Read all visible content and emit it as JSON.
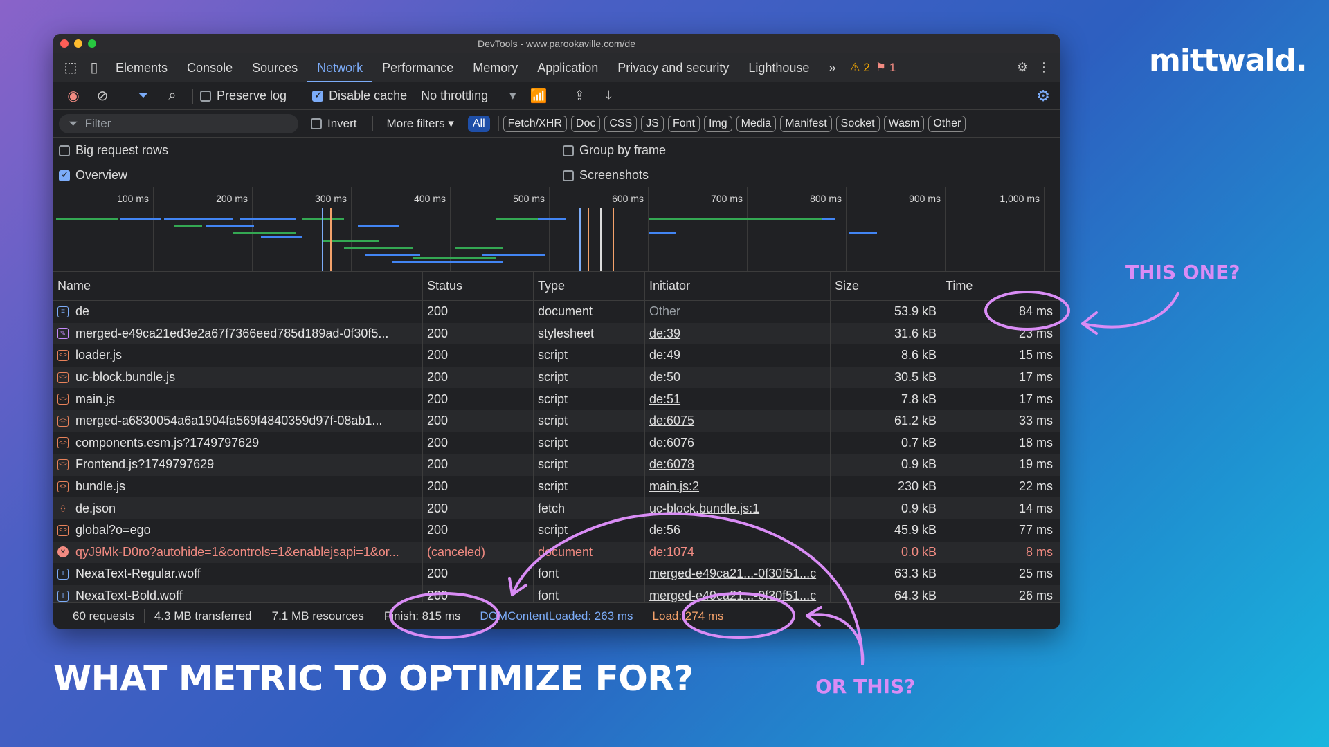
{
  "brand": {
    "logo": "mittwald."
  },
  "headline": "WHAT METRIC TO OPTIMIZE FOR?",
  "annotations": {
    "a": "THIS ONE?",
    "b": "OR THIS?"
  },
  "window": {
    "title": "DevTools - www.parookaville.com/de"
  },
  "tabs": {
    "items": [
      "Elements",
      "Console",
      "Sources",
      "Network",
      "Performance",
      "Memory",
      "Application",
      "Privacy and security",
      "Lighthouse"
    ],
    "active": "Network",
    "more": "»",
    "warnings": "2",
    "errors": "1"
  },
  "toolbar": {
    "preserve_log": "Preserve log",
    "disable_cache": "Disable cache",
    "throttling": "No throttling"
  },
  "filter": {
    "placeholder": "Filter",
    "invert": "Invert",
    "more_filters": "More filters",
    "chips": [
      "All",
      "Fetch/XHR",
      "Doc",
      "CSS",
      "JS",
      "Font",
      "Img",
      "Media",
      "Manifest",
      "Socket",
      "Wasm",
      "Other"
    ]
  },
  "options": {
    "big_rows": "Big request rows",
    "overview": "Overview",
    "group_by_frame": "Group by frame",
    "screenshots": "Screenshots"
  },
  "overview_ticks": [
    "100 ms",
    "200 ms",
    "300 ms",
    "400 ms",
    "500 ms",
    "600 ms",
    "700 ms",
    "800 ms",
    "900 ms",
    "1,000 ms"
  ],
  "table": {
    "headers": [
      "Name",
      "Status",
      "Type",
      "Initiator",
      "Size",
      "Time"
    ],
    "rows": [
      {
        "name": "de",
        "status": "200",
        "type": "document",
        "initiator": "Other",
        "size": "53.9 kB",
        "time": "84 ms"
      },
      {
        "name": "merged-e49ca21ed3e2a67f7366eed785d189ad-0f30f5...",
        "status": "200",
        "type": "stylesheet",
        "initiator": "de:39",
        "size": "31.6 kB",
        "time": "23 ms"
      },
      {
        "name": "loader.js",
        "status": "200",
        "type": "script",
        "initiator": "de:49",
        "size": "8.6 kB",
        "time": "15 ms"
      },
      {
        "name": "uc-block.bundle.js",
        "status": "200",
        "type": "script",
        "initiator": "de:50",
        "size": "30.5 kB",
        "time": "17 ms"
      },
      {
        "name": "main.js",
        "status": "200",
        "type": "script",
        "initiator": "de:51",
        "size": "7.8 kB",
        "time": "17 ms"
      },
      {
        "name": "merged-a6830054a6a1904fa569f4840359d97f-08ab1...",
        "status": "200",
        "type": "script",
        "initiator": "de:6075",
        "size": "61.2 kB",
        "time": "33 ms"
      },
      {
        "name": "components.esm.js?1749797629",
        "status": "200",
        "type": "script",
        "initiator": "de:6076",
        "size": "0.7 kB",
        "time": "18 ms"
      },
      {
        "name": "Frontend.js?1749797629",
        "status": "200",
        "type": "script",
        "initiator": "de:6078",
        "size": "0.9 kB",
        "time": "19 ms"
      },
      {
        "name": "bundle.js",
        "status": "200",
        "type": "script",
        "initiator": "main.js:2",
        "size": "230 kB",
        "time": "22 ms"
      },
      {
        "name": "de.json",
        "status": "200",
        "type": "fetch",
        "initiator": "uc-block.bundle.js:1",
        "size": "0.9 kB",
        "time": "14 ms"
      },
      {
        "name": "global?o=ego",
        "status": "200",
        "type": "script",
        "initiator": "de:56",
        "size": "45.9 kB",
        "time": "77 ms"
      },
      {
        "name": "qyJ9Mk-D0ro?autohide=1&controls=1&enablejsapi=1&or...",
        "status": "(canceled)",
        "type": "document",
        "initiator": "de:1074",
        "size": "0.0 kB",
        "time": "8 ms"
      },
      {
        "name": "NexaText-Regular.woff",
        "status": "200",
        "type": "font",
        "initiator": "merged-e49ca21...-0f30f51...c",
        "size": "63.3 kB",
        "time": "25 ms"
      },
      {
        "name": "NexaText-Bold.woff",
        "status": "200",
        "type": "font",
        "initiator": "merged-e49ca21...-0f30f51...c",
        "size": "64.3 kB",
        "time": "26 ms"
      }
    ]
  },
  "status": {
    "requests": "60 requests",
    "transferred": "4.3 MB transferred",
    "resources": "7.1 MB resources",
    "finish": "Finish: 815 ms",
    "dcl": "DOMContentLoaded: 263 ms",
    "load": "Load: 274 ms"
  },
  "colors": {
    "accent": "#7cacf8",
    "annotation": "#d98cf5",
    "dcl": "#7cacf8",
    "load": "#f4a26b"
  }
}
